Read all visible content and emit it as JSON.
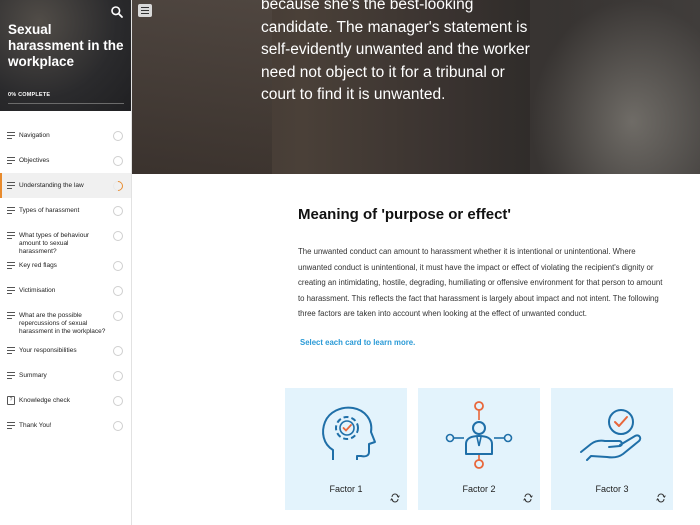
{
  "sidebar": {
    "course_title": "Sexual harassment in the workplace",
    "progress_label": "0% COMPLETE",
    "progress": 0,
    "icons": {
      "search": "search-icon"
    },
    "items": [
      {
        "label": "Navigation",
        "status": "not-started"
      },
      {
        "label": "Objectives",
        "status": "not-started"
      },
      {
        "label": "Understanding the law",
        "status": "in-progress"
      },
      {
        "label": "Types of harassment",
        "status": "not-started"
      },
      {
        "label": "What types of behaviour amount to sexual harassment?",
        "status": "not-started"
      },
      {
        "label": "Key red flags",
        "status": "not-started"
      },
      {
        "label": "Victimisation",
        "status": "not-started"
      },
      {
        "label": "What are the possible repercussions of sexual harassment in the workplace?",
        "status": "not-started"
      },
      {
        "label": "Your responsibilities",
        "status": "not-started"
      },
      {
        "label": "Summary",
        "status": "not-started"
      },
      {
        "label": "Knowledge check",
        "status": "not-started"
      },
      {
        "label": "Thank You!",
        "status": "not-started"
      }
    ]
  },
  "hero": {
    "text": "because she's the best-looking candidate. The manager's statement is self-evidently unwanted and the worker need not object to it for a tribunal or court to find it is unwanted."
  },
  "main": {
    "title": "Meaning of 'purpose or effect'",
    "body": "The unwanted conduct can amount to harassment whether it is intentional or unintentional. Where unwanted conduct is unintentional, it must have the impact or effect of violating the recipient's dignity or creating an intimidating, hostile, degrading, humiliating or offensive environment for that person to amount to harassment. This reflects the fact that harassment is largely about impact and not intent. The following three factors are taken into account when looking at the effect of unwanted conduct.",
    "instruction": "Select each card to learn more.",
    "cards": [
      {
        "label": "Factor 1",
        "icon": "head-gear-icon"
      },
      {
        "label": "Factor 2",
        "icon": "person-network-icon"
      },
      {
        "label": "Factor 3",
        "icon": "hand-check-icon"
      }
    ]
  },
  "colors": {
    "accent": "#e88b2e",
    "link": "#2a9ad6",
    "card_bg": "#e3f3fc",
    "icon_blue": "#1f6fa8",
    "icon_orange": "#e8663a"
  }
}
